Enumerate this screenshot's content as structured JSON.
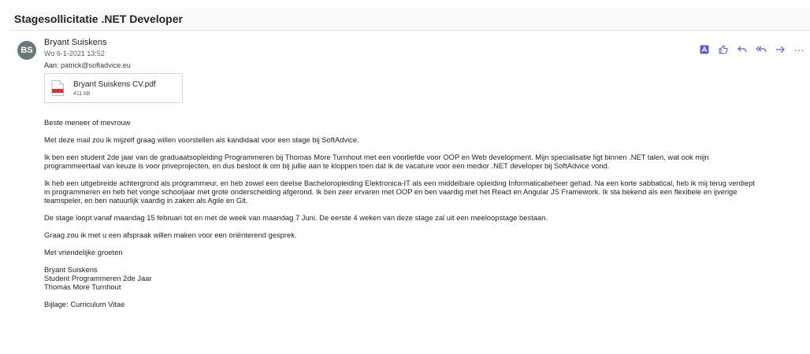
{
  "email": {
    "subject": "Stagesollicitatie .NET Developer",
    "avatar_initials": "BS",
    "sender_name": "Bryant Suiskens",
    "date": "Wo 6-1-2021 13:52",
    "to_label": "Aan:",
    "to_value": "patrick@softadvice.eu"
  },
  "attachment": {
    "name": "Bryant Suiskens CV.pdf",
    "size": "411 kB",
    "icon_text": "pdf"
  },
  "actions": {
    "icons": [
      "pdf-icon",
      "thumbs-up-icon",
      "reply-icon",
      "reply-all-icon",
      "forward-icon",
      "more-icon"
    ],
    "more_label": "···"
  },
  "body": {
    "greeting": "Beste meneer of mevrouw",
    "p1": "Met deze mail zou ik mijzelf graag willen voorstellen als kandidaat voor een stage bij SoftAdvice.",
    "p2_l1": "Ik ben een student 2de jaar van de graduaatsopleiding Programmeren bij Thomas More Turnhout met een voorliefde voor OOP en Web development. Mijn specialisatie ligt binnen .NET talen, wat ook mijn",
    "p2_l2": "programmeertaal van keuze is voor priveprojecten, en dus besloot ik om bij jullie aan te kloppen toen dat ik de vacature voor een medior .NET developer bij SoftAdvice vond.",
    "p3_l1": "Ik heb een uitgebreide achtergrond als programmeur, en heb zowel een deelse Bacheloropleiding Elektronica-IT als een middelbare opleiding Informaticabeheer gehad. Na een korte sabbatical, heb ik mij terug verdiept",
    "p3_l2": "in programmeren en heb het vorige schooljaar met grote onderscheiding afgerond. Ik ben zeer ervaren met OOP en ben vaardig met het React en Angular JS Framework. Ik sta bekend als een flexibele en ijverige",
    "p3_l3": "teamspeler, en ben natuurlijk vaardig in zaken als Agile en Git.",
    "p4": "De stage loopt vanaf maandag 15 februari tot en met de week van maandag 7 Juni. De eerste 4 weken van deze stage zal uit een meeloopstage bestaan.",
    "p5": "Graag zou ik met u een afspraak willen maken voor een oriënterend gesprek.",
    "closing": "Met vriendelijke groeten",
    "sig_name": "Bryant Suiskens",
    "sig_role": "Student Programmeren 2de Jaar",
    "sig_school": "Thomas More Turnhout",
    "attachment_note": "Bijlage: Curriculum Vitae"
  },
  "colors": {
    "accent": "#5b5fc7",
    "avatar": "#69797e",
    "pdf_red": "#d13438"
  }
}
